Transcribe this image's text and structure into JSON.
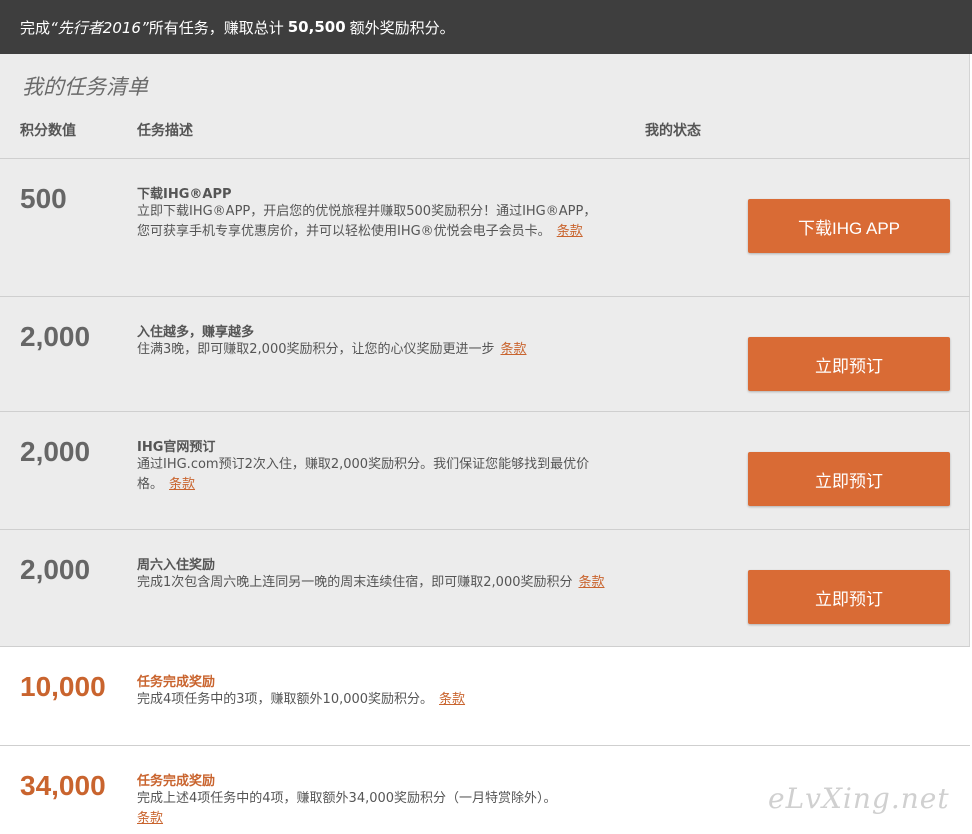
{
  "banner": {
    "prefix": "完成",
    "campaign": "“先行者2016”",
    "middle": "所有任务，赚取总计",
    "total": "50,500",
    "suffix": "额外奖励积分。"
  },
  "list": {
    "title": "我的任务清单",
    "col_points": "积分数值",
    "col_desc": "任务描述",
    "col_status": "我的状态"
  },
  "tasks": [
    {
      "points": "500",
      "title": "下载IHG®APP",
      "desc": "立即下载IHG®APP，开启您的优悦旅程并赚取500奖励积分！通过IHG®APP，您可获享手机专享优惠房价，并可以轻松使用IHG®优悦会电子会员卡。",
      "terms": "条款",
      "button": "下载IHG APP"
    },
    {
      "points": "2,000",
      "title": "入住越多，赚享越多",
      "desc": "住满3晚，即可赚取2,000奖励积分，让您的心仪奖励更进一步",
      "terms": "条款",
      "button": "立即预订"
    },
    {
      "points": "2,000",
      "title": "IHG官网预订",
      "desc": "通过IHG.com预订2次入住，赚取2,000奖励积分。我们保证您能够找到最优价格。",
      "terms": "条款",
      "button": "立即预订"
    },
    {
      "points": "2,000",
      "title": "周六入住奖励",
      "desc": "完成1次包含周六晚上连同另一晚的周末连续住宿，即可赚取2,000奖励积分",
      "terms": "条款",
      "button": "立即预订"
    }
  ],
  "bonuses": [
    {
      "points": "10,000",
      "title": "任务完成奖励",
      "desc": "完成4项任务中的3项，赚取额外10,000奖励积分。",
      "terms": "条款"
    },
    {
      "points": "34,000",
      "title": "任务完成奖励",
      "desc": "完成上述4项任务中的4项，赚取额外34,000奖励积分（一月特赏除外）。",
      "terms": "条款"
    }
  ],
  "watermark": "eLvXing.net",
  "colors": {
    "accent": "#d96b35",
    "banner_bg": "#3e3e3e",
    "panel_bg": "#ececec"
  }
}
